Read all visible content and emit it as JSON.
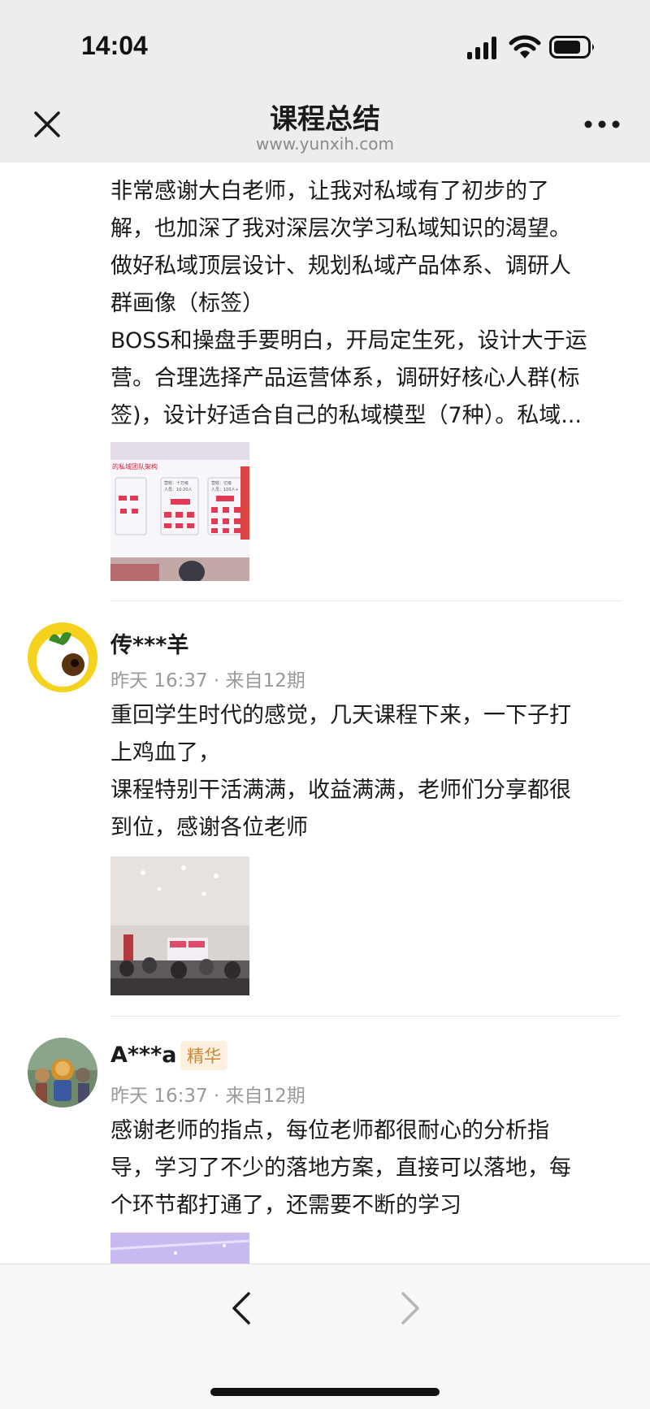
{
  "status_bar": {
    "time": "14:04",
    "icons": [
      "signal-icon",
      "wifi-icon",
      "battery-icon"
    ]
  },
  "nav": {
    "title": "课程总结",
    "url": "www.yunxih.com",
    "icons": [
      "close-icon",
      "more-icon"
    ]
  },
  "posts": [
    {
      "lines": [
        "非常感谢大白老师，让我对私域有了初步的了",
        "解，也加深了我对深层次学习私域知识的渴望。",
        "做好私域顶层设计、规划私域产品体系、调研人",
        "群画像（标签）",
        "BOSS和操盘手要明白，开局定生死，设计大于运",
        "营。合理选择产品运营体系，调研好核心人群(标",
        "签)，设计好适合自己的私域模型（7种）。私域..."
      ],
      "image": {
        "type": "slide-photo",
        "slide_title": "的私域团队架构",
        "slide_labels": [
          "营收：十万级",
          "人员：10-20人",
          "营收：亿级",
          "人员：100人+"
        ]
      }
    },
    {
      "username": "传***羊",
      "time": "昨天 16:37",
      "separator": "·",
      "source": "来自12期",
      "lines": [
        "重回学生时代的感觉，几天课程下来，一下子打",
        "上鸡血了，",
        "课程特别干活满满，收益满满，老师们分享都很",
        "到位，感谢各位老师"
      ],
      "image": {
        "type": "classroom-photo"
      }
    },
    {
      "username": "A***a",
      "badge": "精华",
      "time": "昨天 16:37",
      "separator": "·",
      "source": "来自12期",
      "lines": [
        "感谢老师的指点，每位老师都很耐心的分析指",
        "导，学习了不少的落地方案，直接可以落地，每",
        "个环节都打通了，还需要不断的学习"
      ],
      "image": {
        "type": "ceiling-photo"
      }
    }
  ],
  "toolbar": {
    "icons": [
      "back-icon",
      "forward-icon"
    ]
  },
  "colors": {
    "bar_background": "#ededed",
    "meta_gray": "#9a9a9a",
    "badge_text": "#c8873a",
    "badge_bg": "#fdf0df"
  }
}
